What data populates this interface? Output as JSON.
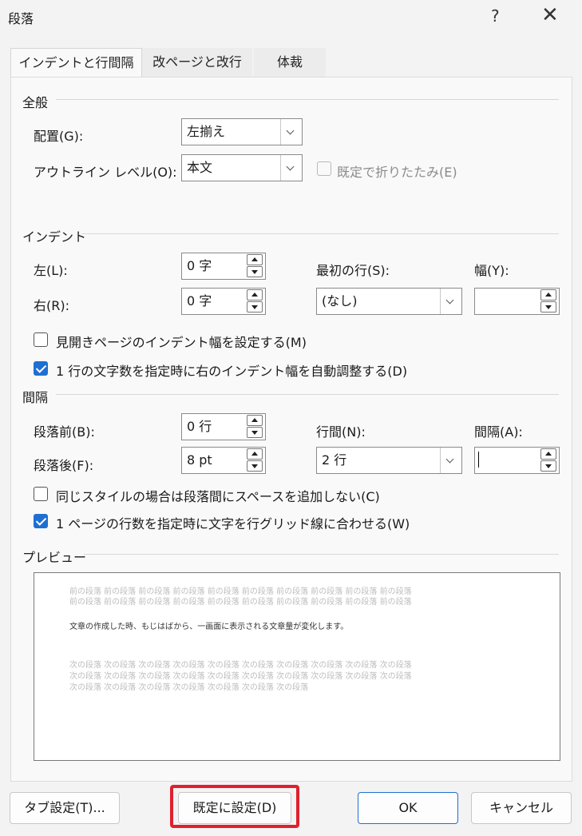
{
  "window": {
    "title": "段落",
    "help": "?",
    "close": "✕"
  },
  "tabs": [
    "インデントと行間隔",
    "改ページと改行",
    "体裁"
  ],
  "general": {
    "section": "全般",
    "alignment_label": "配置(G):",
    "alignment_value": "左揃え",
    "outline_label": "アウトライン レベル(O):",
    "outline_value": "本文",
    "collapse_label": "既定で折りたたみ(E)"
  },
  "indent": {
    "section": "インデント",
    "left_label": "左(L):",
    "left_value": "0 字",
    "right_label": "右(R):",
    "right_value": "0 字",
    "first_line_label": "最初の行(S):",
    "first_line_value": "(なし)",
    "width_label": "幅(Y):",
    "width_value": "",
    "mirror_label": "見開きページのインデント幅を設定する(M)",
    "mirror_checked": false,
    "auto_adjust_label": "1 行の文字数を指定時に右のインデント幅を自動調整する(D)",
    "auto_adjust_checked": true
  },
  "spacing": {
    "section": "間隔",
    "before_label": "段落前(B):",
    "before_value": "0 行",
    "after_label": "段落後(F):",
    "after_value": "8 pt",
    "line_label": "行間(N):",
    "line_value": "2 行",
    "at_label": "間隔(A):",
    "at_value": "",
    "no_space_label": "同じスタイルの場合は段落間にスペースを追加しない(C)",
    "no_space_checked": false,
    "grid_label": "1 ページの行数を指定時に文字を行グリッド線に合わせる(W)",
    "grid_checked": true
  },
  "preview": {
    "section": "プレビュー",
    "prev_line1": "前の段落 前の段落 前の段落 前の段落 前の段落 前の段落 前の段落 前の段落 前の段落 前の段落",
    "prev_line2": "前の段落 前の段落 前の段落 前の段落 前の段落 前の段落 前の段落 前の段落 前の段落 前の段落",
    "sample": "文章の作成した時、もじはばから、一画面に表示される文章量が変化します。",
    "next_line1": "次の段落 次の段落 次の段落 次の段落 次の段落 次の段落 次の段落 次の段落 次の段落 次の段落",
    "next_line2": "次の段落 次の段落 次の段落 次の段落 次の段落 次の段落 次の段落 次の段落 次の段落 次の段落",
    "next_line3": "次の段落 次の段落 次の段落 次の段落 次の段落 次の段落 次の段落"
  },
  "buttons": {
    "tabs": "タブ設定(T)...",
    "default": "既定に設定(D)",
    "ok": "OK",
    "cancel": "キャンセル"
  },
  "colors": {
    "accent": "#1f6fd2",
    "highlight": "#e0202e"
  }
}
